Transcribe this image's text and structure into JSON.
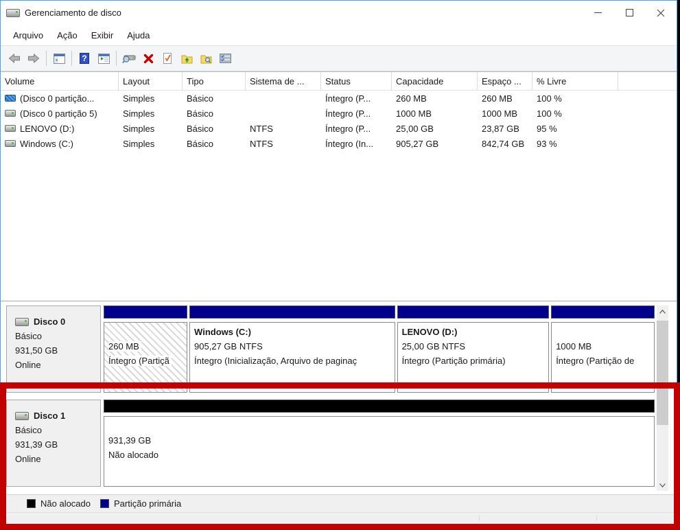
{
  "window": {
    "title": "Gerenciamento de disco",
    "controls": [
      "minimize",
      "maximize",
      "close"
    ]
  },
  "menu": {
    "items": [
      "Arquivo",
      "Ação",
      "Exibir",
      "Ajuda"
    ]
  },
  "toolbar": {
    "icons": [
      "back-icon",
      "forward-icon",
      "show-console-tree-icon",
      "help-icon",
      "show-action-pane-icon",
      "device-search-icon",
      "delete-icon",
      "task-check-icon",
      "folder-up-icon",
      "folder-search-icon",
      "properties-icon"
    ]
  },
  "volume_list": {
    "columns": [
      "Volume",
      "Layout",
      "Tipo",
      "Sistema de ...",
      "Status",
      "Capacidade",
      "Espaço ...",
      "% Livre"
    ],
    "rows": [
      {
        "volume": "(Disco 0 partição...",
        "layout": "Simples",
        "tipo": "Básico",
        "fs": "",
        "status": "Íntegro (P...",
        "capacity": "260 MB",
        "free_space": "260 MB",
        "pct_free": "100 %"
      },
      {
        "volume": "(Disco 0 partição 5)",
        "layout": "Simples",
        "tipo": "Básico",
        "fs": "",
        "status": "Íntegro (P...",
        "capacity": "1000 MB",
        "free_space": "1000 MB",
        "pct_free": "100 %"
      },
      {
        "volume": "LENOVO (D:)",
        "layout": "Simples",
        "tipo": "Básico",
        "fs": "NTFS",
        "status": "Íntegro (P...",
        "capacity": "25,00 GB",
        "free_space": "23,87 GB",
        "pct_free": "95 %"
      },
      {
        "volume": "Windows (C:)",
        "layout": "Simples",
        "tipo": "Básico",
        "fs": "NTFS",
        "status": "Íntegro (In...",
        "capacity": "905,27 GB",
        "free_space": "842,74 GB",
        "pct_free": "93 %"
      }
    ]
  },
  "disks": [
    {
      "name": "Disco 0",
      "type": "Básico",
      "size": "931,50 GB",
      "status": "Online",
      "partitions": [
        {
          "name": "",
          "size_line": "260 MB",
          "status_line": "Íntegro (Partiçã",
          "bar_color": "#00008b",
          "selected": true
        },
        {
          "name": "Windows (C:)",
          "size_line": "905,27 GB NTFS",
          "status_line": "Íntegro (Inicialização, Arquivo de paginaç",
          "bar_color": "#00008b",
          "selected": false
        },
        {
          "name": "LENOVO (D:)",
          "size_line": "25,00 GB NTFS",
          "status_line": "Íntegro (Partição primária)",
          "bar_color": "#00008b",
          "selected": false
        },
        {
          "name": "",
          "size_line": "1000 MB",
          "status_line": "Íntegro (Partição de",
          "bar_color": "#00008b",
          "selected": false
        }
      ]
    },
    {
      "name": "Disco 1",
      "type": "Básico",
      "size": "931,39 GB",
      "status": "Online",
      "partitions": [
        {
          "name": "",
          "size_line": "931,39 GB",
          "status_line": "Não alocado",
          "bar_color": "#000000",
          "selected": false
        }
      ]
    }
  ],
  "legend": {
    "items": [
      {
        "label": "Não alocado",
        "color": "#000000"
      },
      {
        "label": "Partição primária",
        "color": "#00008b"
      }
    ]
  },
  "annotation": {
    "shape": "rectangle",
    "color": "#c10000",
    "target": "disco-1-row"
  }
}
